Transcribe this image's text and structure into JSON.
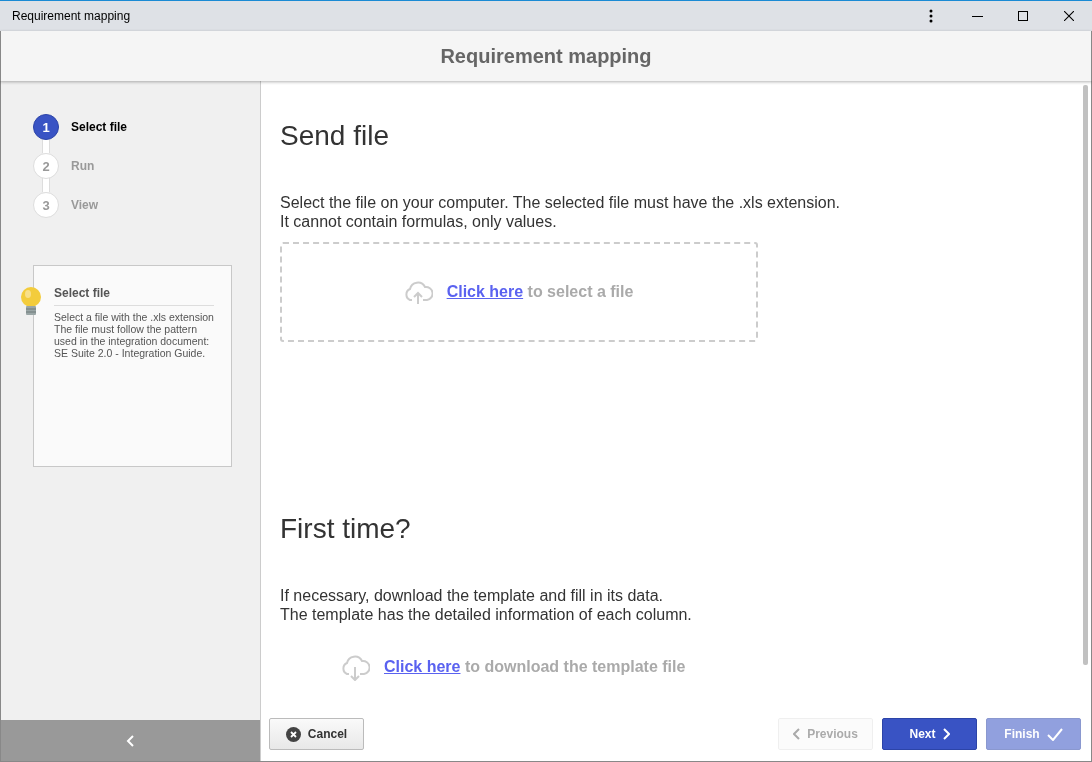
{
  "window": {
    "title": "Requirement mapping"
  },
  "header": {
    "title": "Requirement mapping"
  },
  "steps": [
    {
      "number": "1",
      "label": "Select file",
      "selected": true
    },
    {
      "number": "2",
      "label": "Run",
      "selected": false
    },
    {
      "number": "3",
      "label": "View",
      "selected": false
    }
  ],
  "hint": {
    "title": "Select file",
    "text": "Select a file with the .xls extension\nThe file must follow the pattern used in the integration document: SE Suite 2.0 - Integration Guide."
  },
  "sections": [
    {
      "kind": "upload",
      "heading": "Send file",
      "lines": [
        "Select the file on your computer. The selected file must have the .xls extension.",
        "It cannot contain formulas, only values."
      ],
      "link": "Click here",
      "link_rest": "to select a file"
    },
    {
      "kind": "download",
      "heading": "First time?",
      "lines": [
        "If necessary, download the template and fill in its data.",
        "The template has the detailed information of each column."
      ],
      "link": "Click here",
      "link_rest": "to download the template file"
    }
  ],
  "buttons": [
    {
      "kind": "cancel",
      "label": "Cancel",
      "disabled": false
    },
    {
      "kind": "previous",
      "label": "Previous",
      "disabled": true
    },
    {
      "kind": "next",
      "label": "Next",
      "disabled": false
    },
    {
      "kind": "finish",
      "label": "Finish",
      "disabled": true
    }
  ]
}
